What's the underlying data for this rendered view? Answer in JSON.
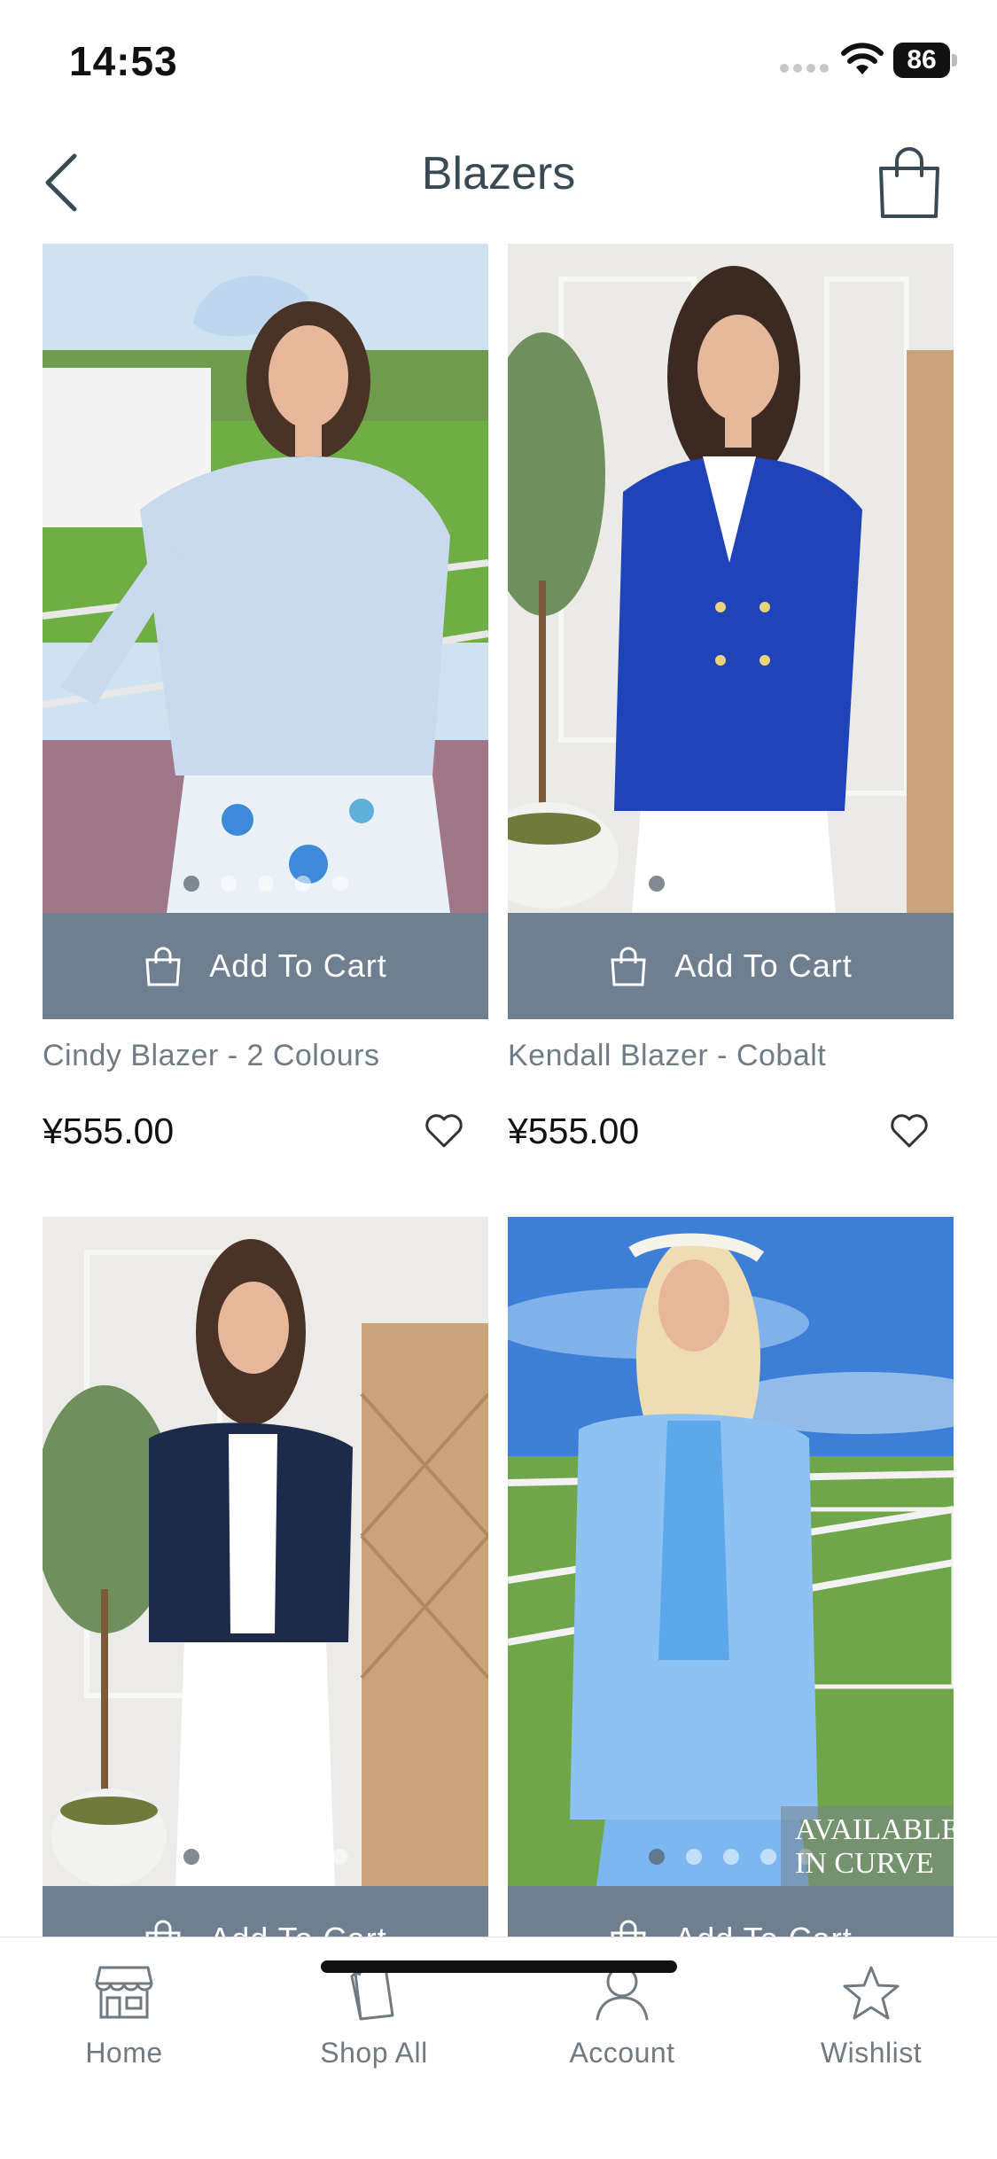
{
  "status_bar": {
    "time": "14:53",
    "battery": "86"
  },
  "nav": {
    "title": "Blazers"
  },
  "products": [
    {
      "name": "Cindy Blazer - 2 Colours",
      "price": "¥555.00",
      "cart_label": "Add To Cart"
    },
    {
      "name": "Kendall Blazer - Cobalt",
      "price": "¥555.00",
      "cart_label": "Add To Cart"
    },
    {
      "name": "",
      "price": "",
      "cart_label": "Add To Cart"
    },
    {
      "name": "",
      "price": "",
      "cart_label": "Add To Cart",
      "badge_line1": "AVAILABLE",
      "badge_line2": "IN CURVE"
    }
  ],
  "tabs": [
    {
      "label": "Home",
      "icon": "storefront-icon"
    },
    {
      "label": "Shop All",
      "icon": "shopping-bag-icon"
    },
    {
      "label": "Account",
      "icon": "person-icon"
    },
    {
      "label": "Wishlist",
      "icon": "star-icon"
    }
  ],
  "colors": {
    "cart_button": "#6f7f8f",
    "text_dark": "#2d3b44",
    "text_muted": "#707c85"
  }
}
